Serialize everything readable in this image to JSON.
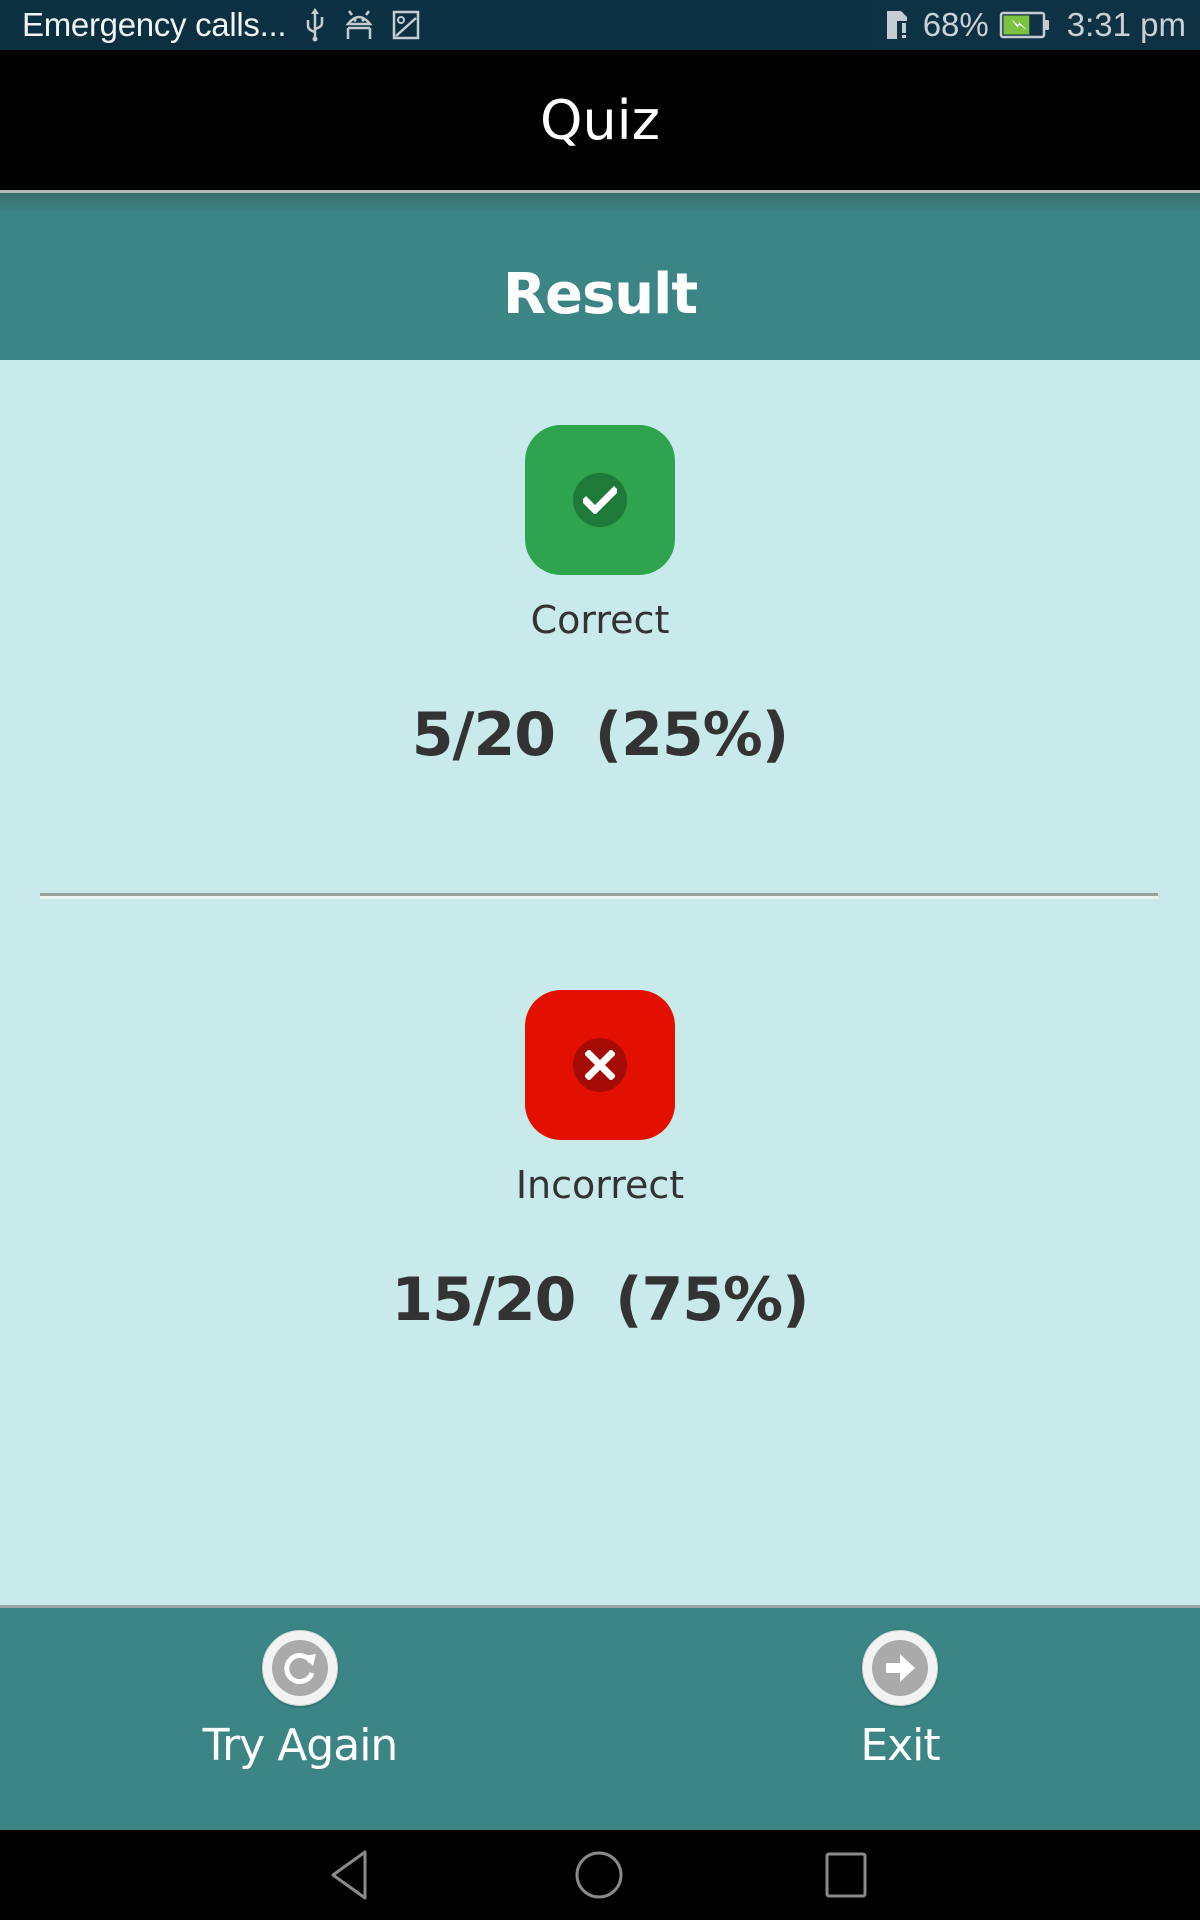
{
  "status_bar": {
    "carrier_text": "Emergency calls...",
    "left_icons": [
      "usb-icon",
      "android-debug-icon",
      "image-icon"
    ],
    "sim_icon": "sim-alert-icon",
    "battery_percent": "68%",
    "battery_level": 0.68,
    "battery_charging": true,
    "time": "3:31 pm"
  },
  "app_bar": {
    "title": "Quiz"
  },
  "result": {
    "header": "Result",
    "correct": {
      "icon": "check-icon",
      "label": "Correct",
      "score": "5/20  (25%)",
      "color": "#2ea44f"
    },
    "incorrect": {
      "icon": "close-icon",
      "label": "Incorrect",
      "score": "15/20  (75%)",
      "color": "#e31000"
    }
  },
  "actions": {
    "try_again": {
      "label": "Try Again",
      "icon": "refresh-icon"
    },
    "exit": {
      "label": "Exit",
      "icon": "arrow-right-icon"
    }
  },
  "nav_bar": {
    "buttons": [
      "back",
      "home",
      "recents"
    ]
  },
  "colors": {
    "header_teal": "#3c8585",
    "content_bg": "#c8eaea",
    "text_dark": "#333333"
  }
}
